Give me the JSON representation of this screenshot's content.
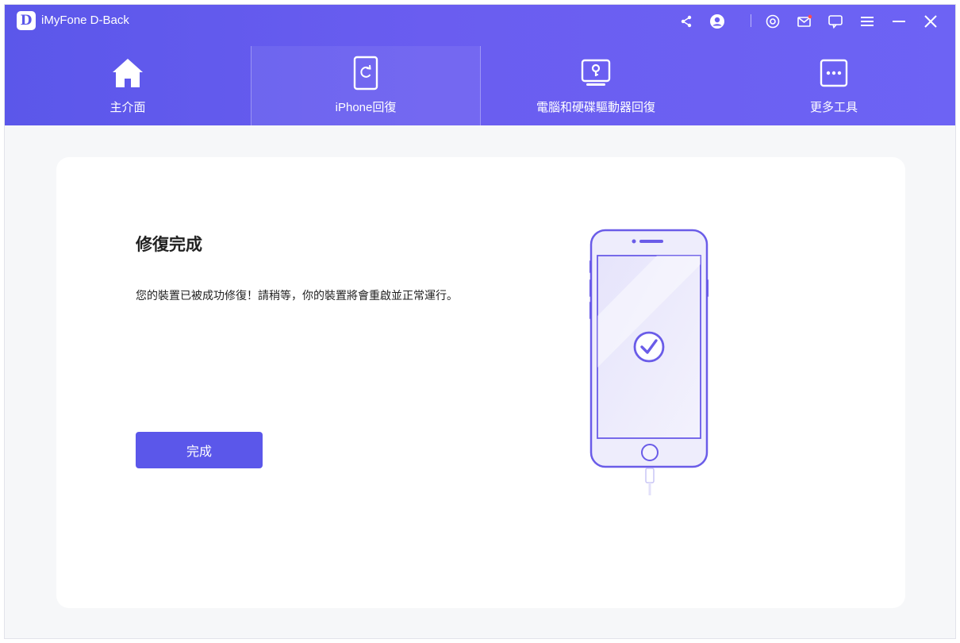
{
  "app": {
    "logo_letter": "D",
    "title": "iMyFone D-Back"
  },
  "titlebar": {
    "icons": [
      "share-icon",
      "account-icon",
      "settings-icon",
      "mail-icon",
      "feedback-icon",
      "menu-icon",
      "minimize-icon",
      "close-icon"
    ],
    "mail_badge_color": "#ff4d4f"
  },
  "nav": {
    "items": [
      {
        "label": "主介面",
        "icon": "home-icon"
      },
      {
        "label": "iPhone回復",
        "icon": "iphone-recovery-icon"
      },
      {
        "label": "電腦和硬碟驅動器回復",
        "icon": "pc-recovery-icon"
      },
      {
        "label": "更多工具",
        "icon": "more-tools-icon"
      }
    ],
    "active_index": 1
  },
  "main": {
    "title": "修復完成",
    "description": "您的裝置已被成功修復！請稍等，你的裝置將會重啟並正常運行。",
    "done_button": "完成"
  },
  "colors": {
    "accent": "#5b57ea",
    "phone_outline": "#6a5ce8",
    "phone_fill": "#eeedfc"
  }
}
